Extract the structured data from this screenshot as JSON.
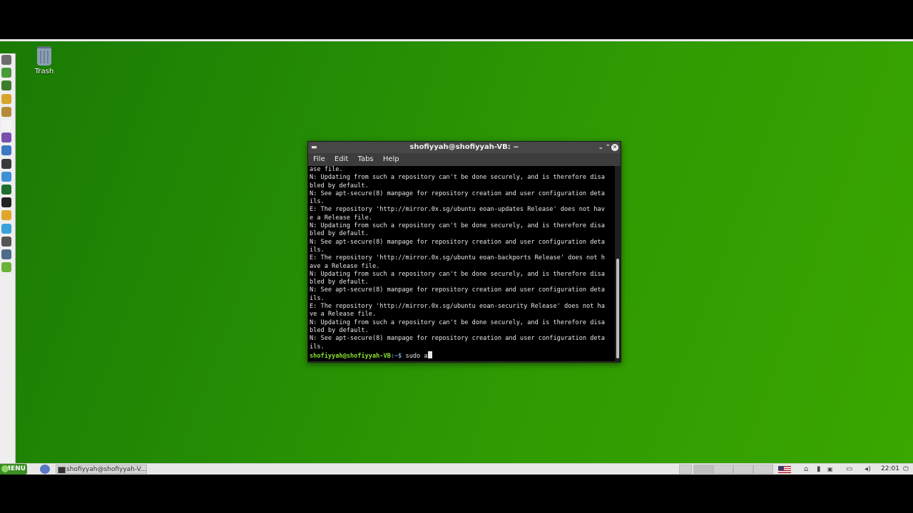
{
  "desktop": {
    "trash_label": "Trash"
  },
  "window": {
    "title": "shofiyyah@shofiyyah-VB: ~",
    "menu": [
      "File",
      "Edit",
      "Tabs",
      "Help"
    ]
  },
  "terminal": {
    "lines": [
      "ase file.",
      "N: Updating from such a repository can't be done securely, and is therefore disa",
      "bled by default.",
      "N: See apt-secure(8) manpage for repository creation and user configuration deta",
      "ils.",
      "E: The repository 'http://mirror.0x.sg/ubuntu eoan-updates Release' does not hav",
      "e a Release file.",
      "N: Updating from such a repository can't be done securely, and is therefore disa",
      "bled by default.",
      "N: See apt-secure(8) manpage for repository creation and user configuration deta",
      "ils.",
      "E: The repository 'http://mirror.0x.sg/ubuntu eoan-backports Release' does not h",
      "ave a Release file.",
      "N: Updating from such a repository can't be done securely, and is therefore disa",
      "bled by default.",
      "N: See apt-secure(8) manpage for repository creation and user configuration deta",
      "ils.",
      "E: The repository 'http://mirror.0x.sg/ubuntu eoan-security Release' does not ha",
      "ve a Release file.",
      "N: Updating from such a repository can't be done securely, and is therefore disa",
      "bled by default.",
      "N: See apt-secure(8) manpage for repository creation and user configuration deta",
      "ils."
    ],
    "prompt_user": "shofiyyah@shofiyyah-VB",
    "prompt_path": ":~$",
    "command": " sudo a"
  },
  "panel": {
    "menu_label": "MENU",
    "task_label": "shofiyyah@shofiyyah-V...",
    "clock": "22:01",
    "colors": {
      "accent": "#3b8e24",
      "desktop": "#2a9303"
    }
  },
  "dock": {
    "icons": [
      "terminal-icon",
      "network-icon",
      "battery-icon",
      "cd-icon",
      "photo-icon",
      "files-icon",
      "camera-icon",
      "screenshot-icon",
      "monitor-icon",
      "info-icon",
      "activity-icon",
      "app-icon",
      "pencil-icon",
      "telegram-icon",
      "upload-icon",
      "grid-icon",
      "leaf-icon"
    ]
  }
}
